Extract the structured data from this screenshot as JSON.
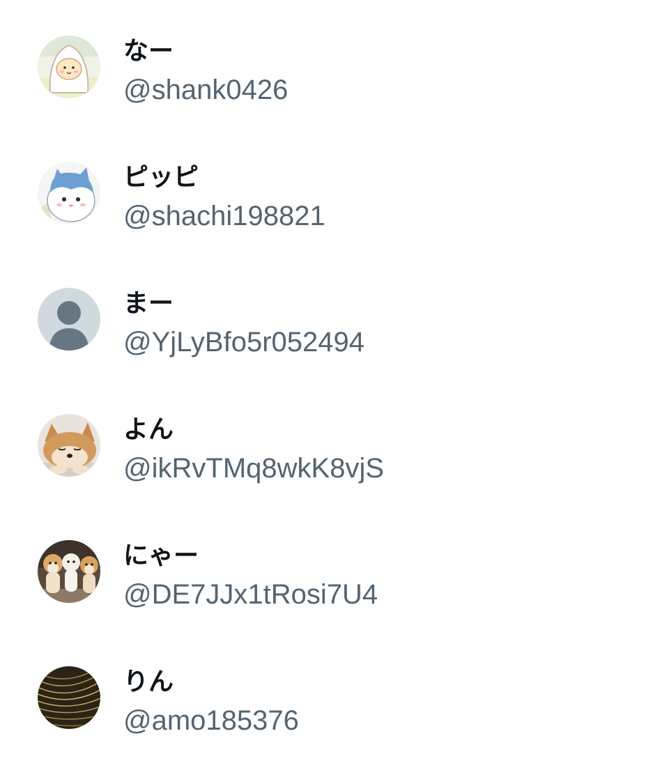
{
  "users": [
    {
      "name": "なー",
      "handle": "@shank0426",
      "avatar_icon": "cartoon-character-hood-icon"
    },
    {
      "name": "ピッピ",
      "handle": "@shachi198821",
      "avatar_icon": "cartoon-cat-character-icon"
    },
    {
      "name": "まー",
      "handle": "@YjLyBfo5r052494",
      "avatar_icon": "default-person-icon"
    },
    {
      "name": "よん",
      "handle": "@ikRvTMq8wkK8vjS",
      "avatar_icon": "sleeping-shiba-dog-icon"
    },
    {
      "name": "にゃー",
      "handle": "@DE7JJx1tRosi7U4",
      "avatar_icon": "three-puppies-icon"
    },
    {
      "name": "りん",
      "handle": "@amo185376",
      "avatar_icon": "golden-light-lines-icon"
    }
  ],
  "colors": {
    "name": "#0f1419",
    "handle": "#536471",
    "default_avatar_bg": "#cfd9de",
    "default_avatar_fg": "#687684"
  }
}
